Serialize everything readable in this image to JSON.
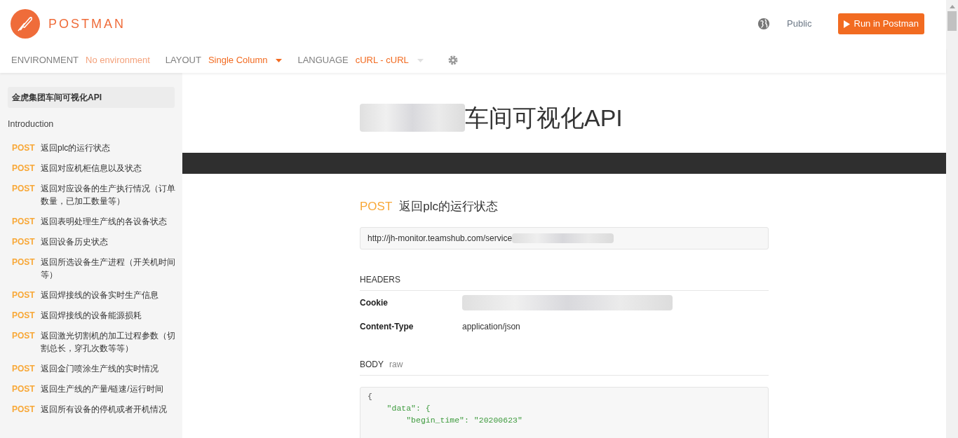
{
  "header": {
    "brand": "POSTMAN",
    "visibility": "Public",
    "run_button": "Run in Postman"
  },
  "toolbar": [
    {
      "label": "ENVIRONMENT",
      "value": "No environment",
      "kind": "plain"
    },
    {
      "label": "LAYOUT",
      "value": "Single Column",
      "kind": "dropdown"
    },
    {
      "label": "LANGUAGE",
      "value": "cURL - cURL",
      "kind": "dropdown-muted"
    }
  ],
  "sidebar": {
    "collection": "金虎集团车间可视化API",
    "intro": "Introduction",
    "items": [
      {
        "method": "POST",
        "name": "返回plc的运行状态"
      },
      {
        "method": "POST",
        "name": "返回对应机柜信息以及状态"
      },
      {
        "method": "POST",
        "name": "返回对应设备的生产执行情况（订单数量，已加工数量等）"
      },
      {
        "method": "POST",
        "name": "返回表明处理生产线的各设备状态"
      },
      {
        "method": "POST",
        "name": "返回设备历史状态"
      },
      {
        "method": "POST",
        "name": "返回所选设备生产进程（开关机时间等）"
      },
      {
        "method": "POST",
        "name": "返回焊接线的设备实时生产信息"
      },
      {
        "method": "POST",
        "name": "返回焊接线的设备能源损耗"
      },
      {
        "method": "POST",
        "name": "返回激光切割机的加工过程参数（切割总长，穿孔次数等等）"
      },
      {
        "method": "POST",
        "name": "返回金门喷涂生产线的实时情况"
      },
      {
        "method": "POST",
        "name": "返回生产线的产量/链速/运行时间"
      },
      {
        "method": "POST",
        "name": "返回所有设备的停机或者开机情况"
      }
    ]
  },
  "main": {
    "title": "车间可视化API",
    "request": {
      "method": "POST",
      "name": "返回plc的运行状态",
      "url": "http://jh-monitor.teamshub.com/service",
      "headers_title": "HEADERS",
      "headers": [
        {
          "key": "Cookie",
          "value_redacted": true
        },
        {
          "key": "Content-Type",
          "value": "application/json"
        }
      ],
      "body_title": "BODY",
      "body_mode": "raw",
      "body_lines": [
        {
          "text": "{",
          "kind": "punct"
        },
        {
          "text": "    \"data\": {",
          "kind": "key"
        },
        {
          "text": "        \"begin_time\": \"20200623\"",
          "kind": "key"
        }
      ]
    }
  }
}
